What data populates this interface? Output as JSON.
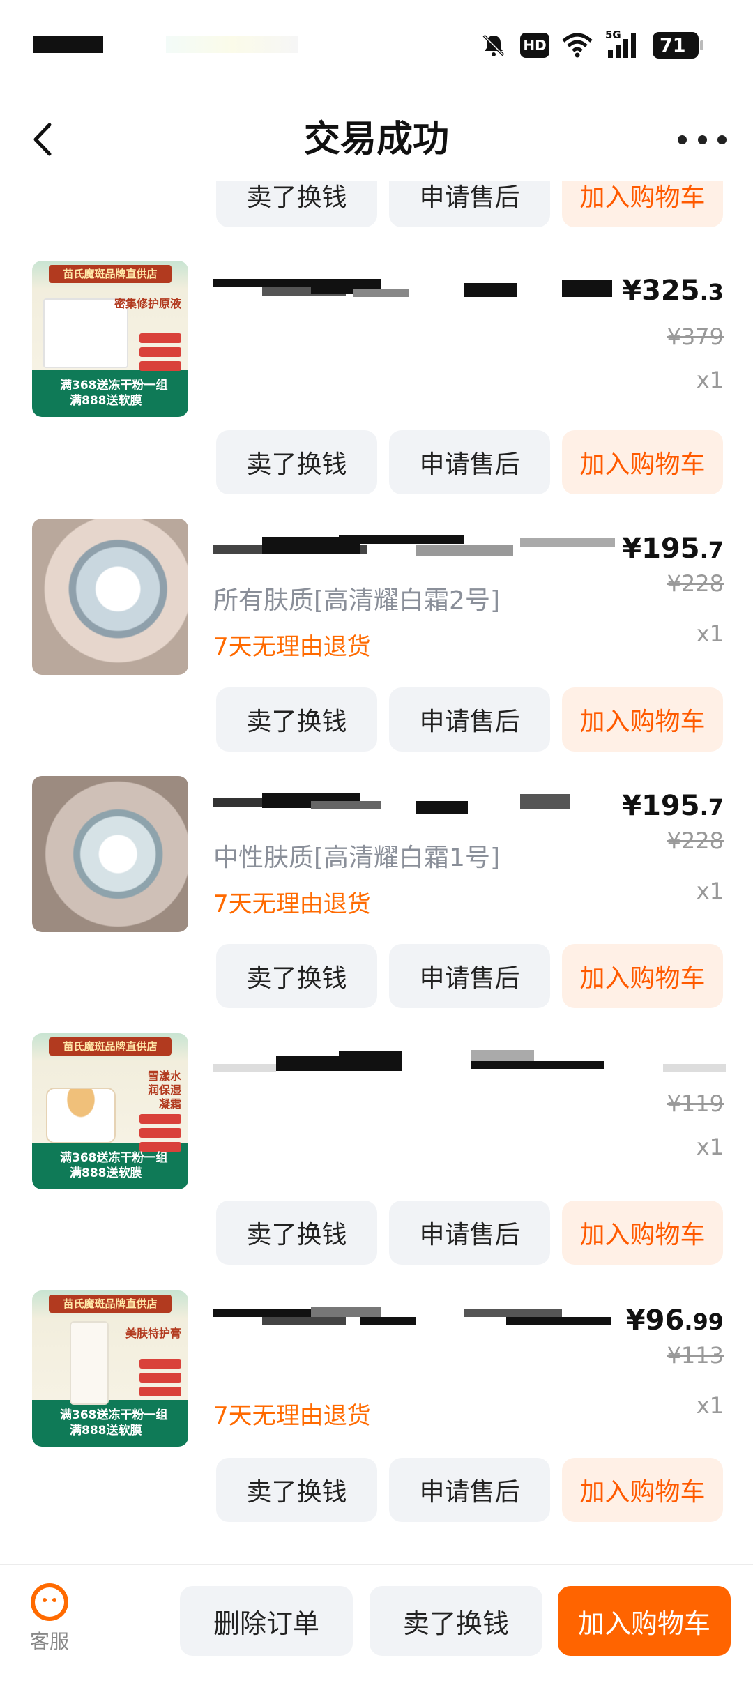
{
  "status_bar": {
    "hd_label": "HD",
    "network_label": "5G",
    "battery_level": "71",
    "icons": [
      "mute-bell-icon",
      "wifi-icon",
      "signal-icon",
      "battery-icon"
    ]
  },
  "header": {
    "title": "交易成功",
    "back_icon": "back-arrow-icon",
    "more_icon": "more-dots-icon"
  },
  "actions": {
    "sell_label": "卖了换钱",
    "aftersale_label": "申请售后",
    "add_cart_label": "加入购物车"
  },
  "items": [
    {
      "price_symbol": "¥",
      "price_int": "325",
      "price_dec": ".3",
      "orig_price": "¥379",
      "qty": "x1",
      "spec": "",
      "return_tag": ""
    },
    {
      "price_symbol": "¥",
      "price_int": "195",
      "price_dec": ".7",
      "orig_price": "¥228",
      "qty": "x1",
      "spec": "所有肤质[高清耀白霜2号]",
      "return_tag": "7天无理由退货"
    },
    {
      "price_symbol": "¥",
      "price_int": "195",
      "price_dec": ".7",
      "orig_price": "¥228",
      "qty": "x1",
      "spec": "中性肤质[高清耀白霜1号]",
      "return_tag": "7天无理由退货"
    },
    {
      "price_symbol": "",
      "price_int": "",
      "price_dec": "",
      "orig_price": "¥119",
      "qty": "x1",
      "spec": "",
      "return_tag": ""
    },
    {
      "price_symbol": "¥",
      "price_int": "96",
      "price_dec": ".99",
      "orig_price": "¥113",
      "qty": "x1",
      "spec": "",
      "return_tag": "7天无理由退货"
    }
  ],
  "thumbs": {
    "banner_text": "苗氏魔斑品牌直供店",
    "promo_line1": "满368送冻干粉一组",
    "promo_line2": "满888送软膜",
    "headline1": "密集修护原液",
    "headline4": "雪漾水润保湿凝霜",
    "headline5": "美肤特护膏"
  },
  "bottom_bar": {
    "service_label": "客服",
    "service_icon": "smile-service-icon",
    "delete_label": "删除订单",
    "sell_label": "卖了换钱",
    "add_cart_label": "加入购物车"
  }
}
